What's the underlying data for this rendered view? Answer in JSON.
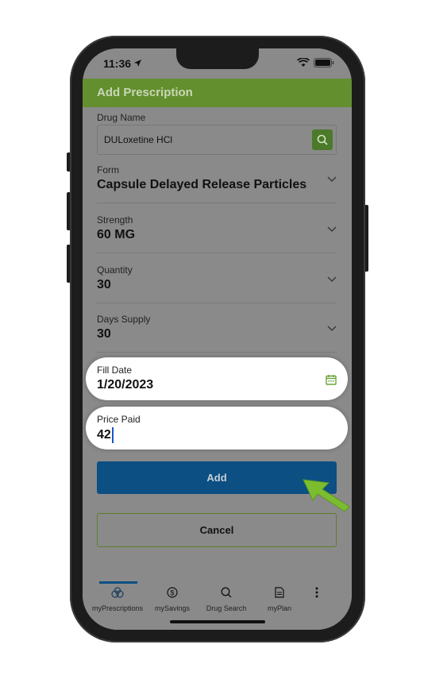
{
  "status": {
    "time": "11:36"
  },
  "appbar": {
    "title": "Add Prescription"
  },
  "form": {
    "drug_name": {
      "label": "Drug Name",
      "value": "DULoxetine HCl"
    },
    "form": {
      "label": "Form",
      "value": "Capsule Delayed Release Particles"
    },
    "strength": {
      "label": "Strength",
      "value": "60 MG"
    },
    "quantity": {
      "label": "Quantity",
      "value": "30"
    },
    "days_supply": {
      "label": "Days Supply",
      "value": "30"
    },
    "fill_date": {
      "label": "Fill Date",
      "value": "1/20/2023"
    },
    "price_paid": {
      "label": "Price Paid",
      "value": "42"
    }
  },
  "buttons": {
    "add": "Add",
    "cancel": "Cancel"
  },
  "tabs": [
    {
      "label": "myPrescriptions",
      "icon": "pills-icon"
    },
    {
      "label": "mySavings",
      "icon": "dollar-icon"
    },
    {
      "label": "Drug Search",
      "icon": "search-icon"
    },
    {
      "label": "myPlan",
      "icon": "document-icon"
    },
    {
      "label": "",
      "icon": "more-vertical-icon"
    }
  ],
  "colors": {
    "appbar": "#638f2f",
    "add_button": "#0c4f82",
    "cursor": "#1a55c9"
  }
}
